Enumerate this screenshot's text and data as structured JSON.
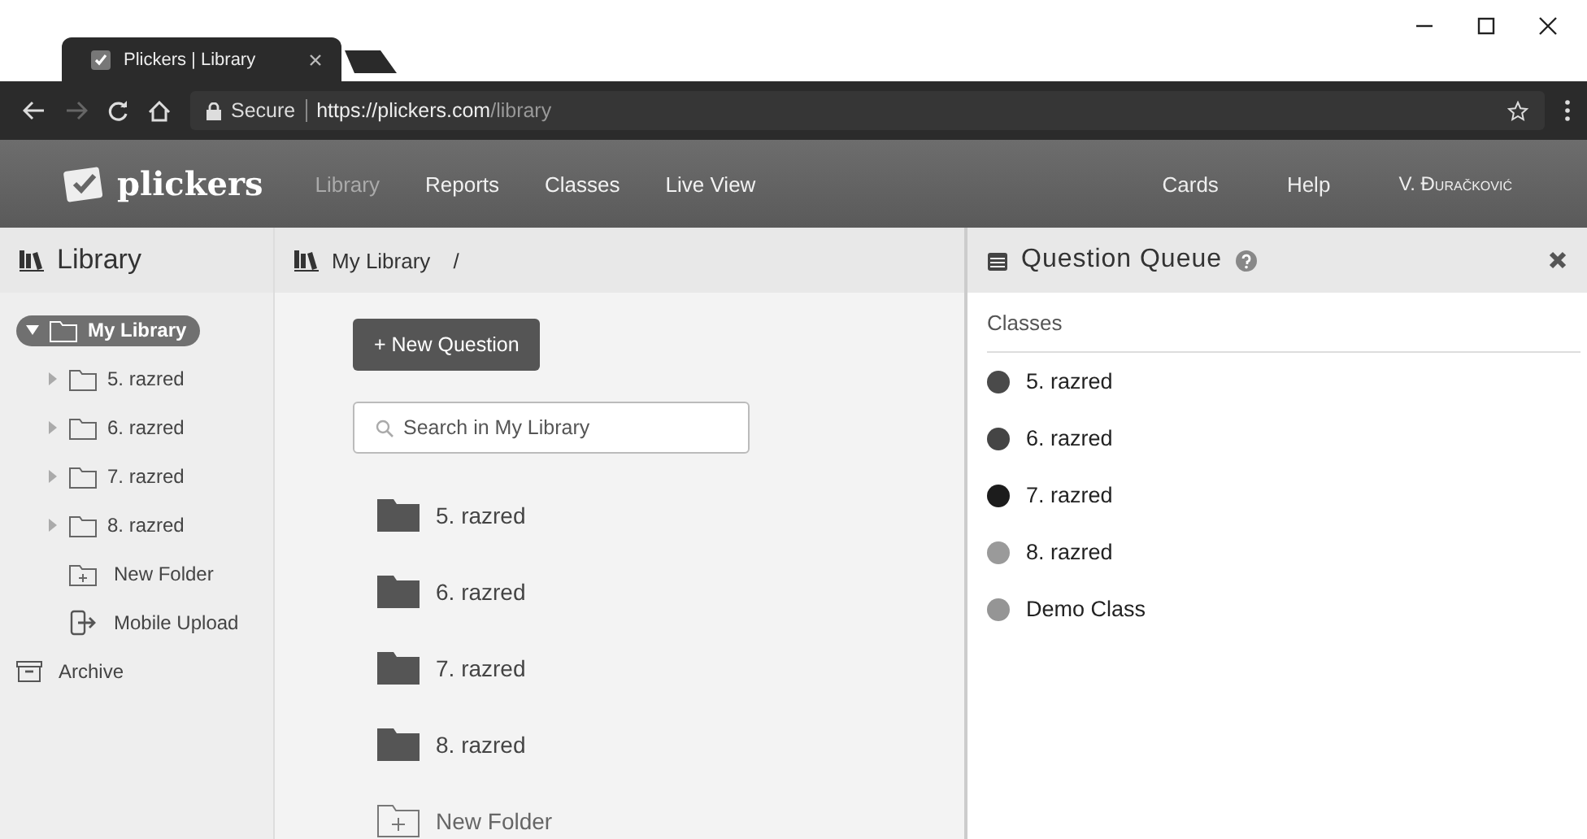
{
  "browser": {
    "tab_title": "Plickers | Library",
    "secure_label": "Secure",
    "url_host": "https://plickers.com",
    "url_path": "/library"
  },
  "nav": {
    "logo": "plickers",
    "links": [
      {
        "label": "Library",
        "selected": true
      },
      {
        "label": "Reports",
        "selected": false
      },
      {
        "label": "Classes",
        "selected": false
      },
      {
        "label": "Live View",
        "selected": false
      }
    ],
    "right_links": [
      "Cards",
      "Help",
      "V. Đuračković"
    ]
  },
  "sidebar": {
    "title": "Library",
    "items": [
      {
        "kind": "folder",
        "label": "My Library",
        "selected": true,
        "expanded": true,
        "children": [
          {
            "kind": "folder",
            "label": "5. razred",
            "selected": false,
            "expanded": false
          },
          {
            "kind": "folder",
            "label": "6. razred",
            "selected": false,
            "expanded": false
          },
          {
            "kind": "folder",
            "label": "7. razred",
            "selected": false,
            "expanded": false
          },
          {
            "kind": "folder",
            "label": "8. razred",
            "selected": false,
            "expanded": false
          },
          {
            "kind": "new-folder",
            "label": "New Folder"
          },
          {
            "kind": "upload",
            "label": "Mobile Upload"
          }
        ]
      },
      {
        "kind": "archive",
        "label": "Archive"
      }
    ]
  },
  "main": {
    "breadcrumb": [
      "My Library",
      "/"
    ],
    "new_button": "+ New Question",
    "search": {
      "placeholder": "Search in My Library"
    },
    "folders": [
      {
        "kind": "folder",
        "label": "5. razred"
      },
      {
        "kind": "folder",
        "label": "6. razred"
      },
      {
        "kind": "folder",
        "label": "7. razred"
      },
      {
        "kind": "folder",
        "label": "8. razred"
      },
      {
        "kind": "new-folder",
        "label": "New Folder"
      }
    ]
  },
  "queue": {
    "title": "Question Queue",
    "section": "Classes",
    "classes": [
      {
        "label": "5. razred",
        "color": "#4a4a4a"
      },
      {
        "label": "6. razred",
        "color": "#454545"
      },
      {
        "label": "7. razred",
        "color": "#1c1c1c"
      },
      {
        "label": "8. razred",
        "color": "#9a9a9a"
      },
      {
        "label": "Demo Class",
        "color": "#959595"
      }
    ]
  }
}
